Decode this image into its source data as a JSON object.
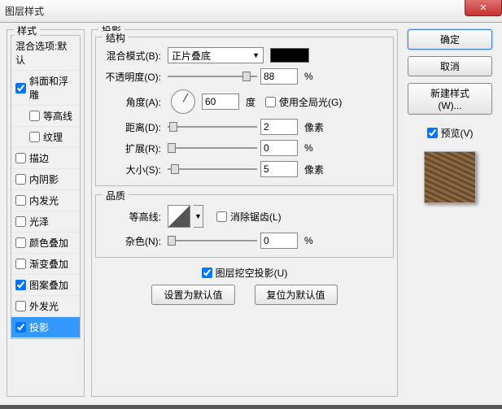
{
  "window": {
    "title": "图层样式",
    "close": "✕"
  },
  "styles_panel": {
    "legend": "样式",
    "blend_options": "混合选项:默认",
    "items": [
      {
        "label": "斜面和浮雕",
        "checked": true
      },
      {
        "label": "等高线",
        "checked": false,
        "indent": true
      },
      {
        "label": "纹理",
        "checked": false,
        "indent": true
      },
      {
        "label": "描边",
        "checked": false
      },
      {
        "label": "内阴影",
        "checked": false
      },
      {
        "label": "内发光",
        "checked": false
      },
      {
        "label": "光泽",
        "checked": false
      },
      {
        "label": "颜色叠加",
        "checked": false
      },
      {
        "label": "渐变叠加",
        "checked": false
      },
      {
        "label": "图案叠加",
        "checked": true
      },
      {
        "label": "外发光",
        "checked": false
      },
      {
        "label": "投影",
        "checked": true,
        "selected": true
      }
    ]
  },
  "shadow_panel": {
    "legend": "投影",
    "structure_legend": "结构",
    "blend_mode_label": "混合模式(B):",
    "blend_mode_value": "正片叠底",
    "opacity_label": "不透明度(O):",
    "opacity_value": "88",
    "percent": "%",
    "angle_label": "角度(A):",
    "angle_value": "60",
    "degree": "度",
    "use_global": "使用全局光(G)",
    "distance_label": "距离(D):",
    "distance_value": "2",
    "pixels": "像素",
    "spread_label": "扩展(R):",
    "spread_value": "0",
    "size_label": "大小(S):",
    "size_value": "5",
    "quality_legend": "品质",
    "contour_label": "等高线:",
    "antialias": "消除锯齿(L)",
    "noise_label": "杂色(N):",
    "noise_value": "0",
    "knockout": "图层挖空投影(U)",
    "make_default": "设置为默认值",
    "reset_default": "复位为默认值"
  },
  "right": {
    "ok": "确定",
    "cancel": "取消",
    "new_style": "新建样式(W)...",
    "preview": "预览(V)"
  }
}
